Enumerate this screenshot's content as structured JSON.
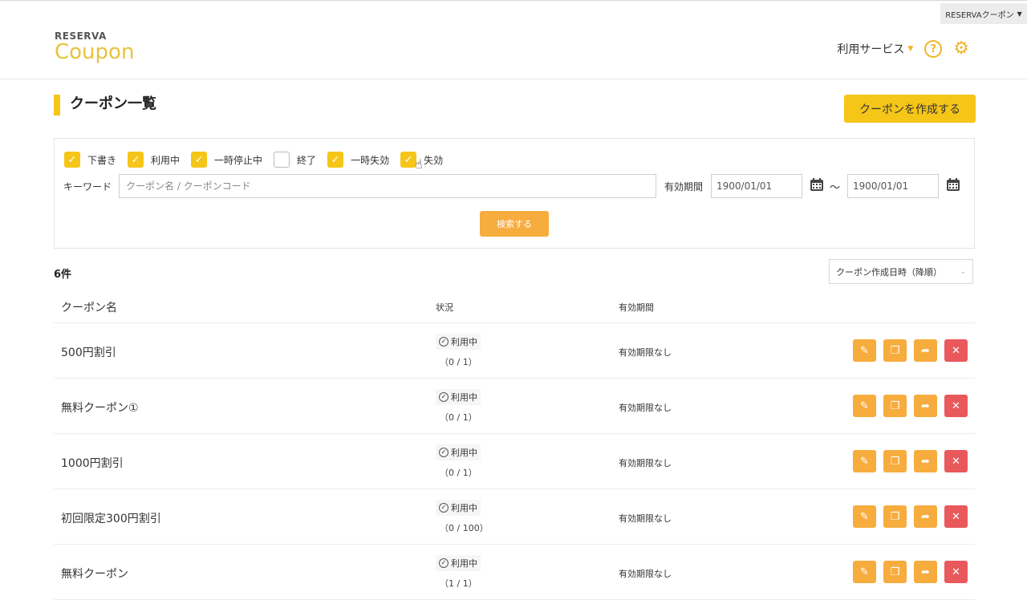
{
  "topbar": {
    "service_switch_label": "RESERVAクーポン"
  },
  "logo": {
    "small": "RESERVA",
    "big": "Coupon"
  },
  "header": {
    "usage_menu": "利用サービス"
  },
  "page": {
    "title": "クーポン一覧",
    "create_button": "クーポンを作成する"
  },
  "filters": {
    "statuses": [
      {
        "label": "下書き",
        "checked": true
      },
      {
        "label": "利用中",
        "checked": true
      },
      {
        "label": "一時停止中",
        "checked": true
      },
      {
        "label": "終了",
        "checked": false
      },
      {
        "label": "一時失効",
        "checked": true
      },
      {
        "label": "失効",
        "checked": true
      }
    ],
    "keyword_label": "キーワード",
    "keyword_placeholder": "クーポン名 / クーポンコード",
    "period_label": "有効期間",
    "date_from": "1900/01/01",
    "date_to": "1900/01/01",
    "tilde": "～",
    "search_button": "検索する"
  },
  "results": {
    "count": "6件",
    "sort": "クーポン作成日時（降順）"
  },
  "table": {
    "headers": {
      "name": "クーポン名",
      "status": "状況",
      "period": "有効期間"
    },
    "rows": [
      {
        "name": "500円割引",
        "status": "利用中",
        "usage": "（0 / 1）",
        "period": "有効期限なし"
      },
      {
        "name": "無料クーポン①",
        "status": "利用中",
        "usage": "（0 / 1）",
        "period": "有効期限なし"
      },
      {
        "name": "1000円割引",
        "status": "利用中",
        "usage": "（0 / 1）",
        "period": "有効期限なし"
      },
      {
        "name": "初回限定300円割引",
        "status": "利用中",
        "usage": "（0 / 100）",
        "period": "有効期限なし"
      },
      {
        "name": "無料クーポン",
        "status": "利用中",
        "usage": "（1 / 1）",
        "period": "有効期限なし"
      }
    ]
  },
  "colors": {
    "accent_yellow": "#f5c518",
    "action_orange": "#f7ac3e",
    "delete_red": "#e9585b"
  },
  "icons": [
    "question-circle-icon",
    "gear-icon",
    "calendar-icon",
    "edit-icon",
    "copy-icon",
    "share-icon",
    "delete-icon",
    "check-circle-icon",
    "pointer-cursor-icon"
  ]
}
